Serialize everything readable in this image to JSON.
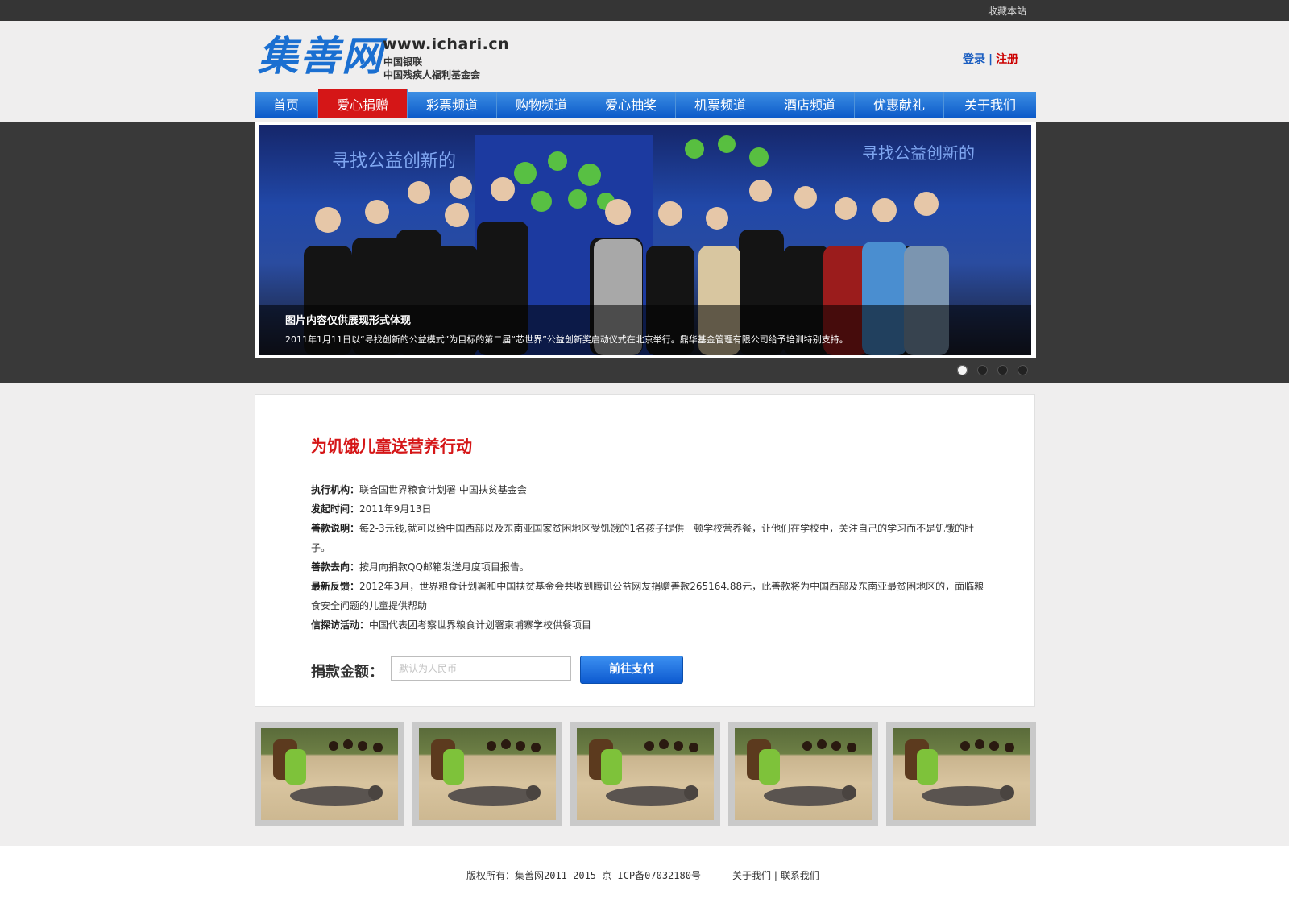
{
  "topbar": {
    "bookmark": "收藏本站"
  },
  "logo": {
    "name": "集善网",
    "url": "www.ichari.cn",
    "sub1": "中国银联",
    "sub2": "中国残疾人福利基金会"
  },
  "auth": {
    "login": "登录",
    "separator": "|",
    "register": "注册"
  },
  "nav": {
    "items": [
      {
        "label": "首页"
      },
      {
        "label": "爱心捐赠",
        "active": true
      },
      {
        "label": "彩票频道"
      },
      {
        "label": "购物频道"
      },
      {
        "label": "爱心抽奖"
      },
      {
        "label": "机票频道"
      },
      {
        "label": "酒店频道"
      },
      {
        "label": "优惠献礼"
      },
      {
        "label": "关于我们"
      }
    ]
  },
  "banner": {
    "caption_title": "图片内容仅供展现形式体现",
    "caption_text": "2011年1月11日以“寻找创新的公益模式”为目标的第二届“芯世界”公益创新奖启动仪式在北京举行。鼎华基金管理有限公司给予培训特别支持。",
    "backdrop_text": "寻找公益创新的",
    "active_slide": 1,
    "slide_count": 4
  },
  "project": {
    "title": "为饥饿儿童送营养行动",
    "rows": [
      {
        "label": "执行机构：",
        "value": "联合国世界粮食计划署 中国扶贫基金会"
      },
      {
        "label": "发起时间：",
        "value": "2011年9月13日"
      },
      {
        "label": "善款说明：",
        "value": "每2-3元钱,就可以给中国西部以及东南亚国家贫困地区受饥饿的1名孩子提供一顿学校营养餐，让他们在学校中，关注自己的学习而不是饥饿的肚子。"
      },
      {
        "label": "善款去向：",
        "value": "按月向捐款QQ邮箱发送月度项目报告。"
      },
      {
        "label": "最新反馈：",
        "value": "2012年3月，世界粮食计划署和中国扶贫基金会共收到腾讯公益网友捐赠善款265164.88元，此善款将为中国西部及东南亚最贫困地区的，面临粮食安全问题的儿童提供帮助"
      },
      {
        "label": "信探访活动：",
        "value": "中国代表团考察世界粮食计划署柬埔寨学校供餐项目"
      }
    ],
    "donate_label": "捐款金额：",
    "donate_placeholder": "默认为人民币",
    "pay_button": "前往支付"
  },
  "thumbnails": [
    {
      "name": "photo-1"
    },
    {
      "name": "photo-2"
    },
    {
      "name": "photo-3"
    },
    {
      "name": "photo-4"
    },
    {
      "name": "photo-5"
    }
  ],
  "footer": {
    "copyright": "版权所有：集善网2011-2015  京 ICP备07032180号",
    "about": "关于我们",
    "divider": "|",
    "contact": "联系我们"
  },
  "colors": {
    "nav_blue": "#0a58c8",
    "active_red": "#d51617",
    "logo_blue": "#1a6fd1"
  }
}
